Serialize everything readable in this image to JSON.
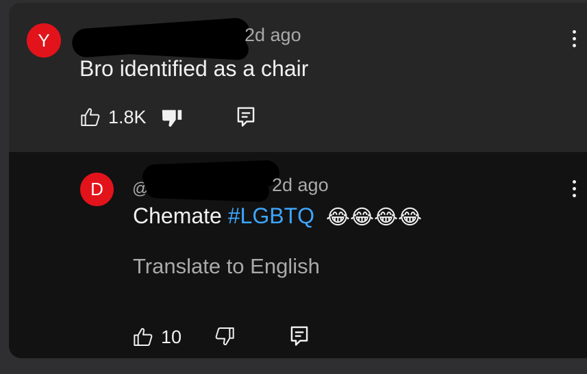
{
  "parent_comment": {
    "avatar_letter": "Y",
    "timestamp": "2d ago",
    "text": "Bro identified as a chair",
    "like_count": "1.8K"
  },
  "reply": {
    "avatar_letter": "D",
    "handle_prefix": "@",
    "timestamp": "2d ago",
    "text": "Chemate",
    "hashtag": "#LGBTQ",
    "emoji": "😂😂😂😂",
    "translate_label": "Translate to English",
    "like_count": "10"
  },
  "icons": {
    "like": "thumb-up-icon",
    "dislike": "thumb-down-icon",
    "reply": "reply-icon",
    "more": "more-vert-icon"
  },
  "colors": {
    "avatar": "#e3131b",
    "hashtag": "#3ea6ff",
    "parent_bg": "#262626",
    "reply_bg": "#121212"
  }
}
